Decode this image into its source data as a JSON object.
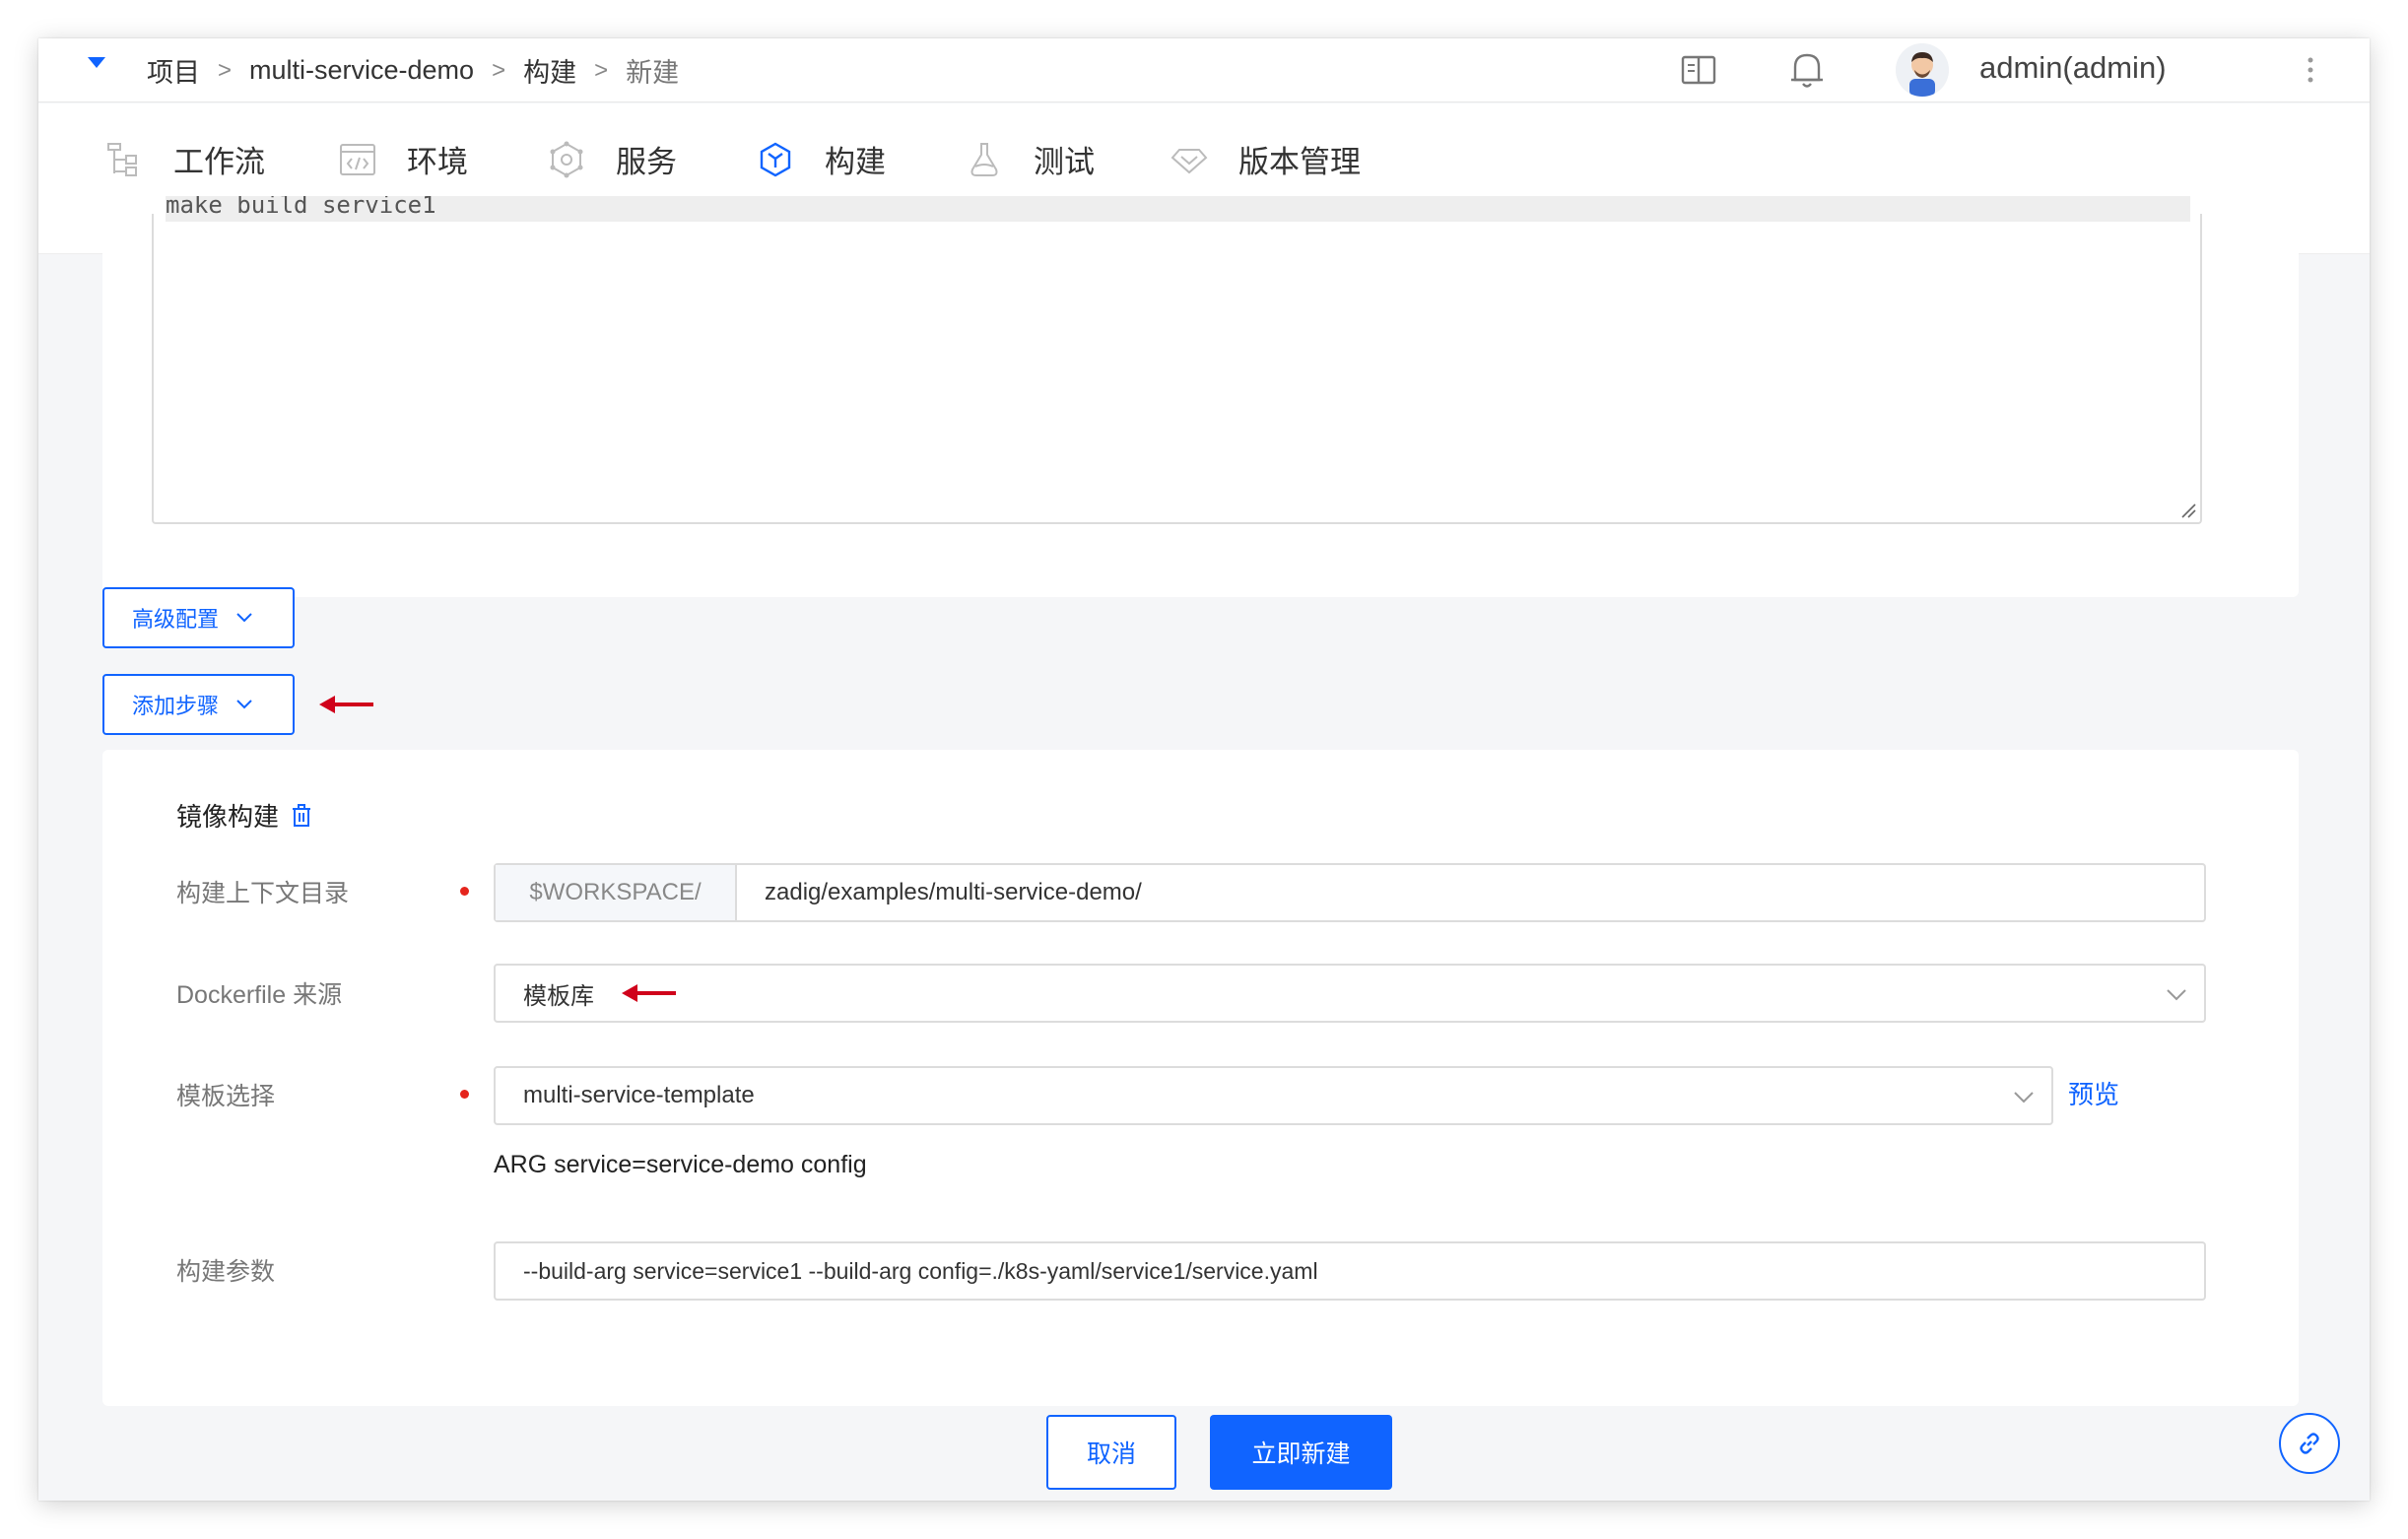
{
  "breadcrumb": {
    "items": [
      "项目",
      "multi-service-demo",
      "构建",
      "新建"
    ],
    "separator": ">"
  },
  "user": {
    "name": "admin(admin)"
  },
  "nav": {
    "tabs": [
      {
        "label": "工作流",
        "icon": "workflow-icon"
      },
      {
        "label": "环境",
        "icon": "environment-icon"
      },
      {
        "label": "服务",
        "icon": "service-icon"
      },
      {
        "label": "构建",
        "icon": "build-icon",
        "active": true
      },
      {
        "label": "测试",
        "icon": "test-icon"
      },
      {
        "label": "版本管理",
        "icon": "version-icon"
      }
    ]
  },
  "script": {
    "line": "make build service1"
  },
  "buttons": {
    "advanced": "高级配置",
    "add_step": "添加步骤",
    "cancel": "取消",
    "create": "立即新建"
  },
  "image_build": {
    "title": "镜像构建",
    "context_label": "构建上下文目录",
    "context_prefix": "$WORKSPACE/",
    "context_value": "zadig/examples/multi-service-demo/",
    "dockerfile_label": "Dockerfile 来源",
    "dockerfile_value": "模板库",
    "template_label": "模板选择",
    "template_value": "multi-service-template",
    "preview": "预览",
    "arg_text": "ARG service=service-demo config",
    "params_label": "构建参数",
    "params_value": "--build-arg service=service1 --build-arg config=./k8s-yaml/service1/service.yaml"
  },
  "colors": {
    "primary": "#1064ff",
    "required": "#e5251d",
    "arrow": "#d0021b"
  }
}
